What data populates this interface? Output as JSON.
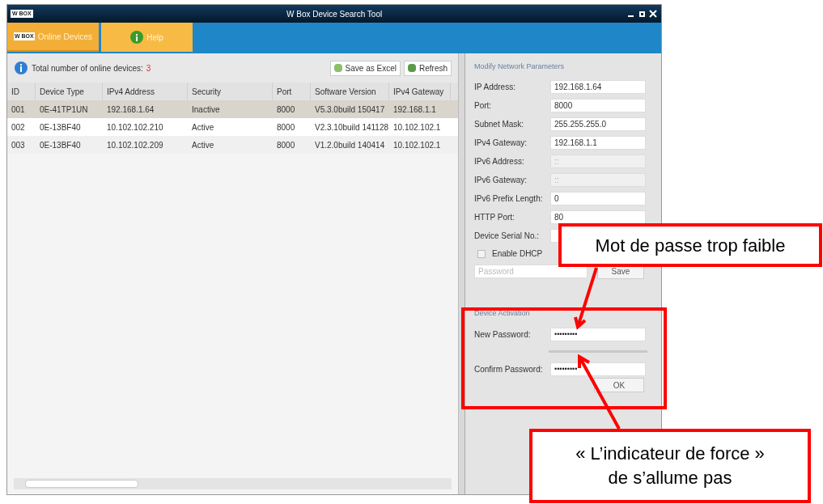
{
  "window": {
    "title": "W Box Device Search Tool",
    "logo": "W BOX"
  },
  "tabs": [
    {
      "label": "Online Devices",
      "selected": true,
      "logo": "W BOX"
    },
    {
      "label": "Help",
      "selected": false
    }
  ],
  "summary": {
    "label": "Total number of online devices:",
    "count": "3"
  },
  "toolbar": [
    "Save as Excel",
    "Refresh"
  ],
  "table": {
    "columns": [
      "ID",
      "Device Type",
      "IPv4 Address",
      "Security",
      "Port",
      "Software Version",
      "IPv4 Gateway"
    ],
    "rows": [
      {
        "selected": true,
        "cells": [
          "001",
          "0E-41TP1UN",
          "192.168.1.64",
          "Inactive",
          "8000",
          "V5.3.0build 150417",
          "192.168.1.1"
        ]
      },
      {
        "selected": false,
        "cells": [
          "002",
          "0E-13BF40",
          "10.102.102.210",
          "Active",
          "8000",
          "V2.3.10build 141128",
          "10.102.102.1"
        ]
      },
      {
        "selected": false,
        "cells": [
          "003",
          "0E-13BF40",
          "10.102.102.209",
          "Active",
          "8000",
          "V1.2.0build 140414",
          "10.102.102.1"
        ]
      }
    ]
  },
  "network": {
    "title": "Modify Network Parameters",
    "fields": [
      {
        "label": "IP Address:",
        "value": "192.168.1.64",
        "disabled": false
      },
      {
        "label": "Port:",
        "value": "8000",
        "disabled": false
      },
      {
        "label": "Subnet Mask:",
        "value": "255.255.255.0",
        "disabled": false
      },
      {
        "label": "IPv4 Gateway:",
        "value": "192.168.1.1",
        "disabled": false
      },
      {
        "label": "IPv6 Address:",
        "value": "::",
        "disabled": true
      },
      {
        "label": "IPv6 Gateway:",
        "value": "::",
        "disabled": true
      },
      {
        "label": "IPv6 Prefix Length:",
        "value": "0",
        "disabled": false
      },
      {
        "label": "HTTP Port:",
        "value": "80",
        "disabled": false
      },
      {
        "label": "Device Serial No.:",
        "disabled": false
      }
    ],
    "dhcp": {
      "label": "Enable DHCP",
      "checked": false
    },
    "password": {
      "placeholder": "Password"
    },
    "save": "Save"
  },
  "activation": {
    "title": "Device Activation",
    "new_password": {
      "label": "New Password:",
      "value": "•••••••••"
    },
    "confirm_password": {
      "label": "Confirm Password:",
      "value": "•••••••••"
    },
    "ok": "OK"
  },
  "annotations": [
    {
      "text": "Mot de passe trop faible"
    },
    {
      "text": "« L’indicateur de force » de s’allume pas"
    }
  ]
}
